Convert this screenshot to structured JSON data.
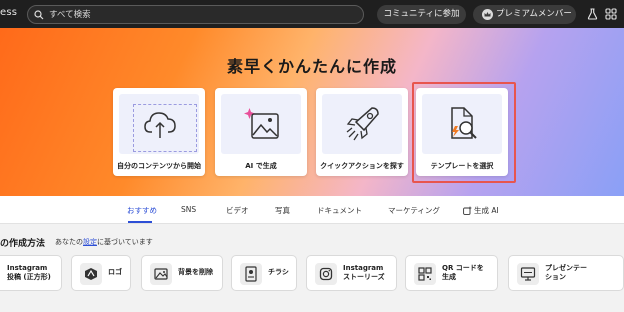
{
  "header": {
    "brand_fragment": "ess",
    "search_placeholder": "すべて検索",
    "community_label": "コミュニティに参加",
    "premium_label": "プレミアムメンバー",
    "icons": [
      "search-icon",
      "crown-icon",
      "flask-icon",
      "apps-grid-icon"
    ]
  },
  "hero": {
    "title": "素早くかんたんに作成",
    "cards": [
      {
        "label": "自分のコンテンツから開始",
        "icon": "cloud-upload-icon"
      },
      {
        "label": "AI で生成",
        "icon": "ai-image-icon"
      },
      {
        "label": "クイックアクションを探す",
        "icon": "rocket-icon"
      },
      {
        "label": "テンプレートを選択",
        "icon": "template-search-icon"
      }
    ]
  },
  "tabs": [
    "おすすめ",
    "SNS",
    "ビデオ",
    "写真",
    "ドキュメント",
    "マーケティング",
    "生成 AI"
  ],
  "active_tab": "おすすめ",
  "suggestions": {
    "heading": "の作成方法",
    "sub_prefix": "あなたの",
    "sub_link": "設定",
    "sub_suffix": "に基づいています",
    "items": [
      {
        "line1": "Instagram",
        "line2": "投稿 (正方形)",
        "icon": ""
      },
      {
        "line1": "ロゴ",
        "line2": "",
        "icon": "logo-icon"
      },
      {
        "line1": "背景を削除",
        "line2": "",
        "icon": "remove-background-icon"
      },
      {
        "line1": "チラシ",
        "line2": "",
        "icon": "flyer-icon"
      },
      {
        "line1": "Instagram",
        "line2": "ストーリーズ",
        "icon": "instagram-icon"
      },
      {
        "line1": "QR コードを",
        "line2": "生成",
        "icon": "qr-code-icon"
      },
      {
        "line1": "プレゼンテー",
        "line2": "ション",
        "icon": "presentation-icon"
      }
    ]
  },
  "colors": {
    "topbar": "#1f1f1f",
    "accent_blue": "#2d4fd6",
    "highlight_red": "#e8554e",
    "hero_orange": "#ff6a1a",
    "hero_purple": "#8aa0f6"
  }
}
